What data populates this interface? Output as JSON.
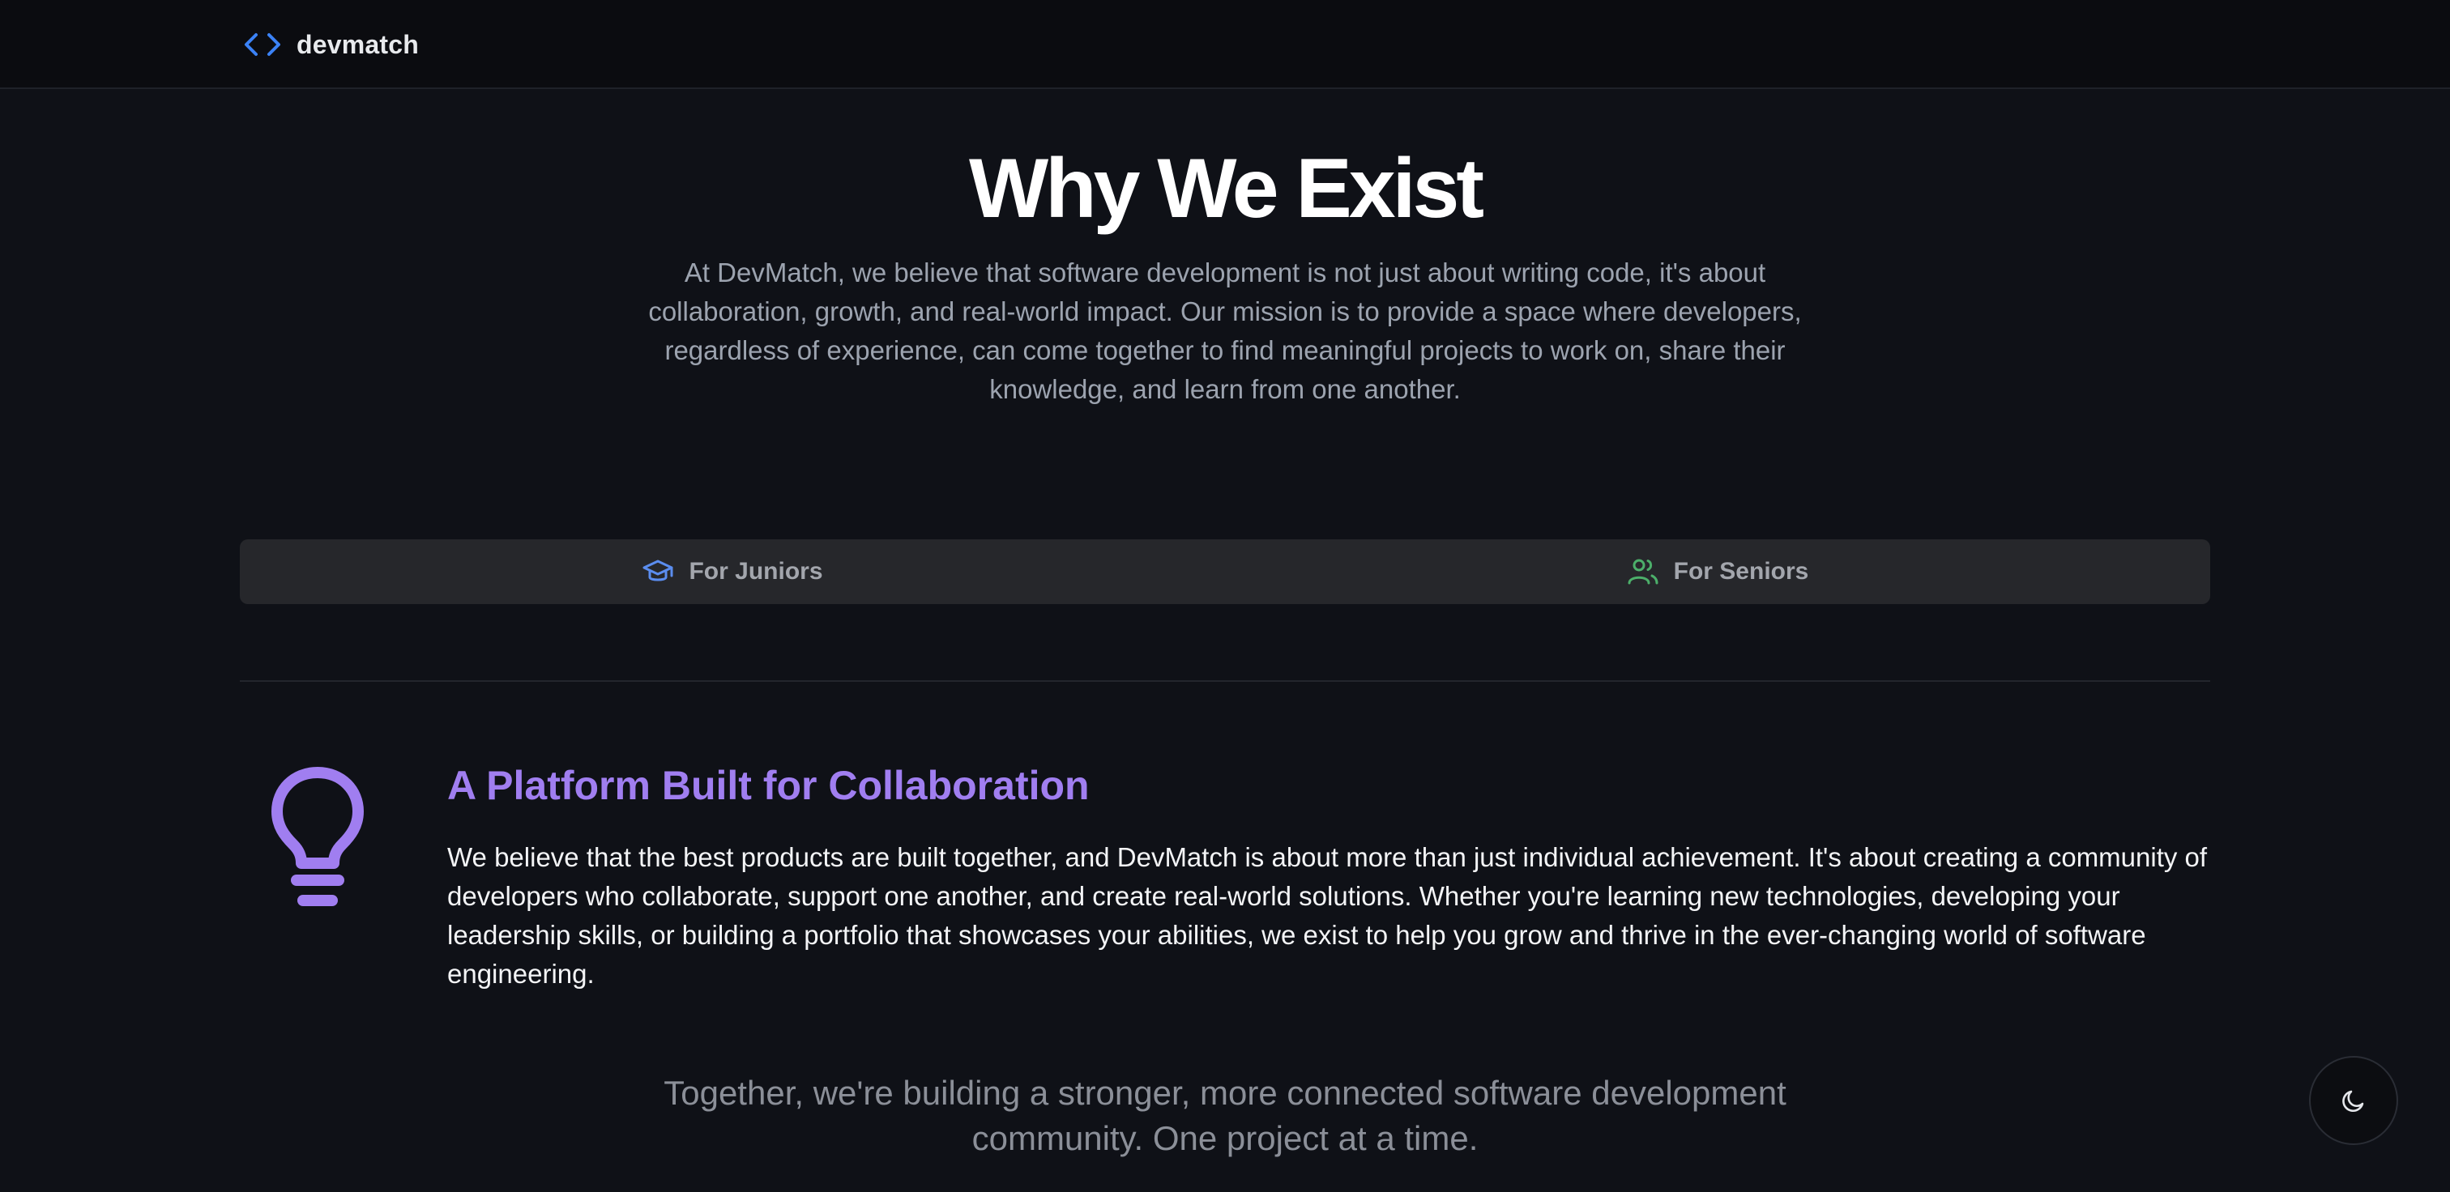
{
  "header": {
    "brand_name": "devmatch",
    "brand_icon": "code-icon"
  },
  "hero": {
    "title": "Why We Exist",
    "description": "At DevMatch, we believe that software development is not just about writing code, it's about collaboration, growth, and real-world impact. Our mission is to provide a space where developers, regardless of experience, can come together to find meaningful projects to work on, share their knowledge, and learn from one another."
  },
  "tabs": [
    {
      "label": "For Juniors",
      "icon": "graduation-cap-icon",
      "icon_color": "#5b8def"
    },
    {
      "label": "For Seniors",
      "icon": "users-icon",
      "icon_color": "#4caf6a"
    }
  ],
  "section": {
    "icon": "lightbulb-icon",
    "title": "A Platform Built for Collaboration",
    "body": "We believe that the best products are built together, and DevMatch is about more than just individual achievement. It's about creating a community of developers who collaborate, support one another, and create real-world solutions. Whether you're learning new technologies, developing your leadership skills, or building a portfolio that showcases your abilities, we exist to help you grow and thrive in the ever-changing world of software engineering.",
    "accent_color": "#a07ef0"
  },
  "closing": {
    "text": "Together, we're building a stronger, more connected software development community. One project at a time."
  },
  "theme_toggle": {
    "icon": "moon-icon"
  },
  "colors": {
    "background": "#0f1117",
    "navbar": "#0b0c10",
    "tab_bar": "#26272b",
    "brand_accent": "#3b82f6"
  }
}
